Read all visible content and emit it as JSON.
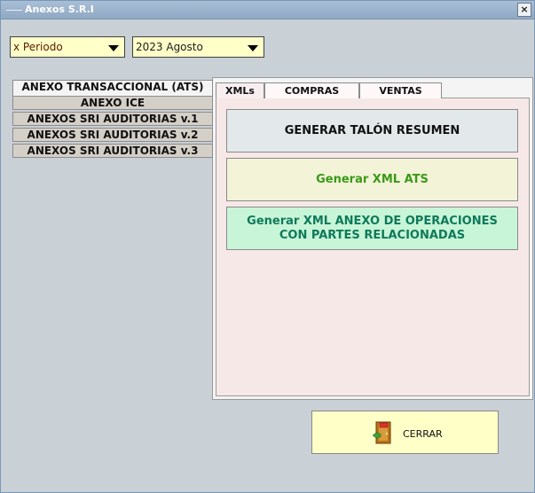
{
  "window": {
    "title": "Anexos S.R.I",
    "close_glyph": "×"
  },
  "filters": {
    "periodo": "x Periodo",
    "mes": "2023 Agosto"
  },
  "left_tabs": [
    {
      "label": "ANEXO TRANSACCIONAL (ATS)"
    },
    {
      "label": "ANEXO ICE"
    },
    {
      "label": "ANEXOS SRI AUDITORIAS v.1"
    },
    {
      "label": "ANEXOS SRI AUDITORIAS v.2"
    },
    {
      "label": "ANEXOS SRI AUDITORIAS v.3"
    }
  ],
  "inner_tabs": [
    {
      "label": "XMLs"
    },
    {
      "label": "COMPRAS"
    },
    {
      "label": "VENTAS"
    }
  ],
  "actions": {
    "talon": "GENERAR TALÓN RESUMEN",
    "ats": "Generar XML ATS",
    "partes": "Generar XML ANEXO DE OPERACIONES CON PARTES RELACIONADAS"
  },
  "footer": {
    "cerrar": "CERRAR",
    "cerrar_icon": "exit-door-icon"
  },
  "colors": {
    "ats_text": "#3a9a18",
    "partes_text": "#0f7a5a",
    "highlight_bg": "#ffffc8"
  }
}
